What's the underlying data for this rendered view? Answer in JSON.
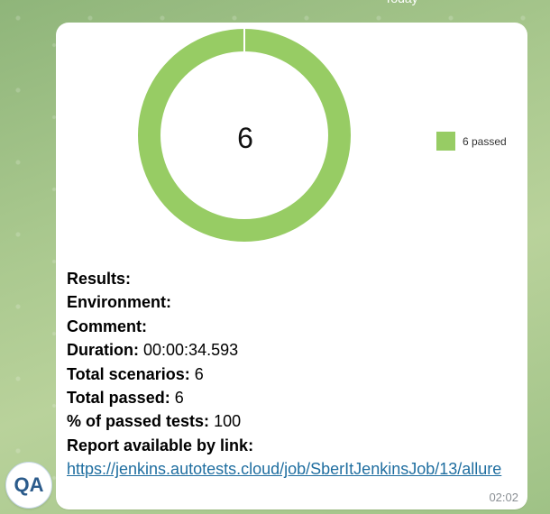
{
  "header": {
    "date_label": "Today"
  },
  "chart_data": {
    "type": "pie",
    "donut": true,
    "total_label": "6",
    "series": [
      {
        "name": "passed",
        "value": 6,
        "color": "#97cc64",
        "legend_label": "6 passed"
      }
    ]
  },
  "message": {
    "fields": [
      {
        "label": "Results:",
        "value": ""
      },
      {
        "label": "Environment:",
        "value": ""
      },
      {
        "label": "Comment:",
        "value": ""
      },
      {
        "label": "Duration:",
        "value": "00:00:34.593"
      },
      {
        "label": "Total scenarios:",
        "value": "6"
      },
      {
        "label": "Total passed:",
        "value": "6"
      },
      {
        "label": "% of passed tests:",
        "value": "100"
      },
      {
        "label": "Report available by link:",
        "value": ""
      }
    ],
    "link": "https://jenkins.autotests.cloud/job/SberItJenkinsJob/13/allure",
    "time": "02:02"
  },
  "sender": {
    "avatar_text": "QA"
  }
}
